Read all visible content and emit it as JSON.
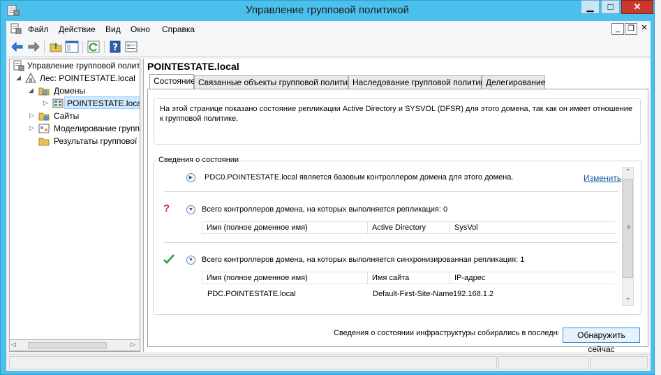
{
  "window": {
    "title": "Управление групповой политикой",
    "colors": {
      "frame": "#4cc0ec",
      "close": "#c7392b",
      "selection": "#cde8ff",
      "link": "#1a5aa6"
    }
  },
  "menu": {
    "items": [
      "Файл",
      "Действие",
      "Вид",
      "Окно",
      "Справка"
    ]
  },
  "toolbar": {
    "icons": [
      "back-icon",
      "forward-icon",
      "up-folder-icon",
      "show-hide-tree-icon",
      "refresh-icon",
      "help-icon",
      "properties-icon"
    ]
  },
  "tree": {
    "items": [
      {
        "label": "Управление групповой полит",
        "icon": "gpo-console-icon"
      },
      {
        "label": "Лес: POINTESTATE.local",
        "icon": "forest-icon"
      },
      {
        "label": "Домены",
        "icon": "domains-folder-icon"
      },
      {
        "label": "POINTESTATE.local",
        "icon": "domain-icon"
      },
      {
        "label": "Сайты",
        "icon": "sites-folder-icon"
      },
      {
        "label": "Моделирование групп",
        "icon": "modeling-icon"
      },
      {
        "label": "Результаты группової",
        "icon": "results-icon"
      }
    ]
  },
  "main": {
    "heading": "POINTESTATE.local",
    "tabs": [
      "Состояние",
      "Связанные объекты групповой политики",
      "Наследование групповой политики",
      "Делегирование"
    ],
    "info_text": "На этой странице показано состояние репликации Active Directory и SYSVOL (DFSR) для этого домена, так как он имеет отношение к групповой политике.",
    "status": {
      "group_title": "Сведения о состоянии",
      "baseline_text": "PDC0.POINTESTATE.local является базовым контроллером домена для этого домена.",
      "change_link": "Изменить",
      "replicating": {
        "text": "Всего контроллеров домена, на которых выполняется репликация: 0",
        "columns": [
          "Имя (полное доменное имя)",
          "Active Directory",
          "SysVol"
        ]
      },
      "synced": {
        "text": "Всего контроллеров домена, на которых выполняется синхронизированная репликация: 1",
        "columns": [
          "Имя (полное доменное имя)",
          "Имя сайта",
          "IP-адрес"
        ],
        "rows": [
          [
            "PDC.POINTESTATE.local",
            "Default-First-Site-Name",
            "192.168.1.2"
          ]
        ]
      }
    },
    "infra_text": "Сведения о состоянии инфраструктуры собирались в последний раз",
    "detect_button": "Обнаружить сейчас"
  }
}
